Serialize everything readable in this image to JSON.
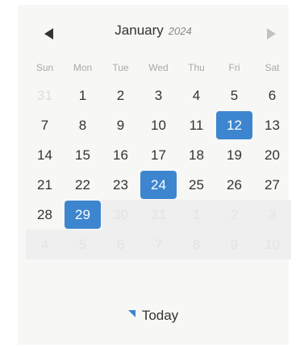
{
  "header": {
    "month": "January",
    "year": "2024",
    "prev_icon": "chevron-left-icon",
    "next_icon": "chevron-right-icon"
  },
  "weekdays": [
    "Sun",
    "Mon",
    "Tue",
    "Wed",
    "Thu",
    "Fri",
    "Sat"
  ],
  "weeks": [
    [
      {
        "label": "31",
        "state": "other"
      },
      {
        "label": "1"
      },
      {
        "label": "2"
      },
      {
        "label": "3"
      },
      {
        "label": "4"
      },
      {
        "label": "5"
      },
      {
        "label": "6"
      }
    ],
    [
      {
        "label": "7"
      },
      {
        "label": "8"
      },
      {
        "label": "9"
      },
      {
        "label": "10"
      },
      {
        "label": "11"
      },
      {
        "label": "12",
        "state": "selected"
      },
      {
        "label": "13"
      }
    ],
    [
      {
        "label": "14"
      },
      {
        "label": "15"
      },
      {
        "label": "16"
      },
      {
        "label": "17"
      },
      {
        "label": "18"
      },
      {
        "label": "19"
      },
      {
        "label": "20"
      }
    ],
    [
      {
        "label": "21"
      },
      {
        "label": "22"
      },
      {
        "label": "23"
      },
      {
        "label": "24",
        "state": "selected"
      },
      {
        "label": "25"
      },
      {
        "label": "26"
      },
      {
        "label": "27"
      }
    ],
    [
      {
        "label": "28"
      },
      {
        "label": "29",
        "state": "selected"
      },
      {
        "label": "30",
        "state": "disabled"
      },
      {
        "label": "31",
        "state": "disabled"
      },
      {
        "label": "1",
        "state": "disabled"
      },
      {
        "label": "2",
        "state": "disabled"
      },
      {
        "label": "3",
        "state": "disabled"
      }
    ],
    [
      {
        "label": "4",
        "state": "disabled"
      },
      {
        "label": "5",
        "state": "disabled"
      },
      {
        "label": "6",
        "state": "disabled"
      },
      {
        "label": "7",
        "state": "disabled"
      },
      {
        "label": "8",
        "state": "disabled"
      },
      {
        "label": "9",
        "state": "disabled"
      },
      {
        "label": "10",
        "state": "disabled"
      }
    ]
  ],
  "footer": {
    "today_label": "Today",
    "today_icon": "corner-triangle-icon"
  },
  "colors": {
    "accent": "#3d86cf",
    "text": "#333333",
    "muted": "#a9a9a9",
    "panel_bg": "#f7f7f5"
  }
}
